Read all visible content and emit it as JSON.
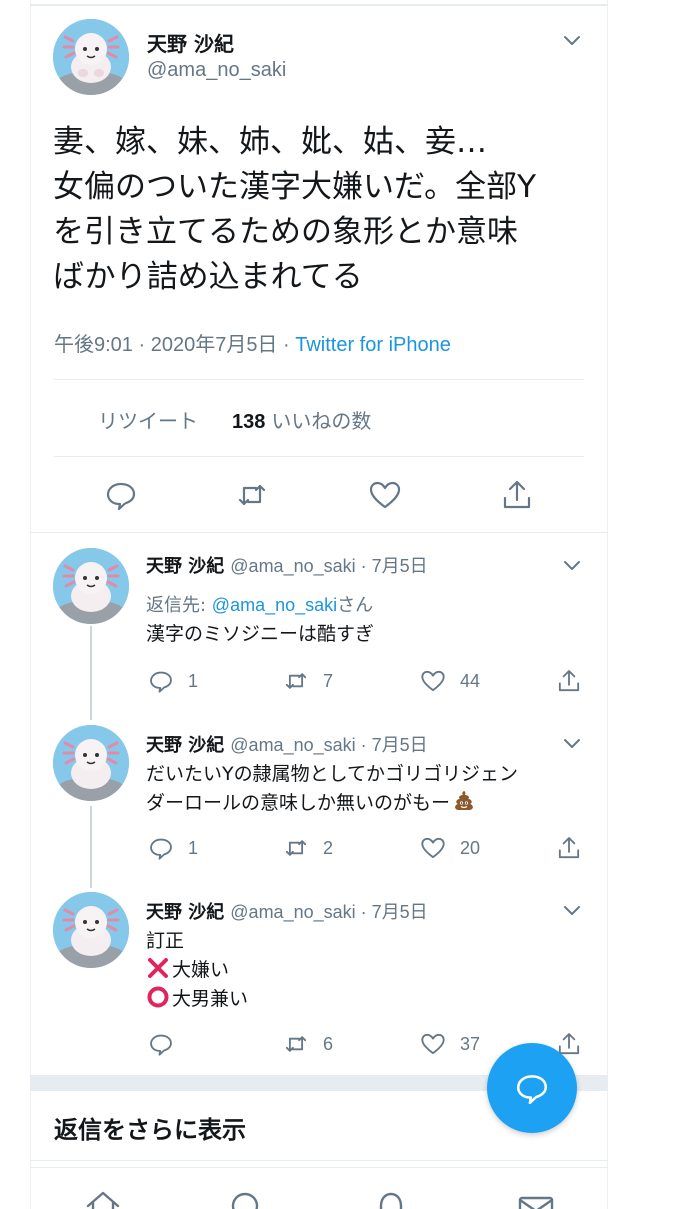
{
  "main_tweet": {
    "author_name": "天野 沙紀",
    "author_handle": "@ama_no_saki",
    "text": "妻、嫁、妹、姉、妣、姑、妾…\n女偏のついた漢字大嫌いだ。全部Y\nを引き立てるための象形とか意味\nばかり詰め込まれてる",
    "time": "午後9:01 · 2020年7月5日 · ",
    "source": "Twitter for iPhone",
    "retweet_label": "リツイート",
    "likes_count": "138",
    "likes_label": "いいねの数"
  },
  "replies": [
    {
      "author_name": "天野 沙紀",
      "meta": "@ama_no_saki · 7月5日",
      "reply_to_prefix": "返信先: ",
      "reply_to_handle": "@ama_no_saki",
      "reply_to_suffix": "さん",
      "lines": [
        "漢字のミソジニーは酷すぎ"
      ],
      "replies_count": "1",
      "retweets_count": "7",
      "likes_count": "44"
    },
    {
      "author_name": "天野 沙紀",
      "meta": "@ama_no_saki · 7月5日",
      "lines": [
        "だいたいYの隷属物としてかゴリゴリジェン",
        "ダーロールの意味しか無いのがもー"
      ],
      "emoji": "pile-of-poo-icon",
      "replies_count": "1",
      "retweets_count": "2",
      "likes_count": "20"
    },
    {
      "author_name": "天野 沙紀",
      "meta": "@ama_no_saki · 7月5日",
      "lines": [
        "訂正",
        "大嫌い",
        "大男兼い"
      ],
      "line_icons": [
        "",
        "cross-mark-icon",
        "circle-mark-icon"
      ],
      "replies_count": "",
      "retweets_count": "6",
      "likes_count": "37"
    }
  ],
  "show_more_replies": "返信をさらに表示",
  "colors": {
    "accent": "#1da1f2",
    "link": "#1b95e0",
    "secondary_text": "#657786",
    "divider": "#e6ecf0"
  }
}
